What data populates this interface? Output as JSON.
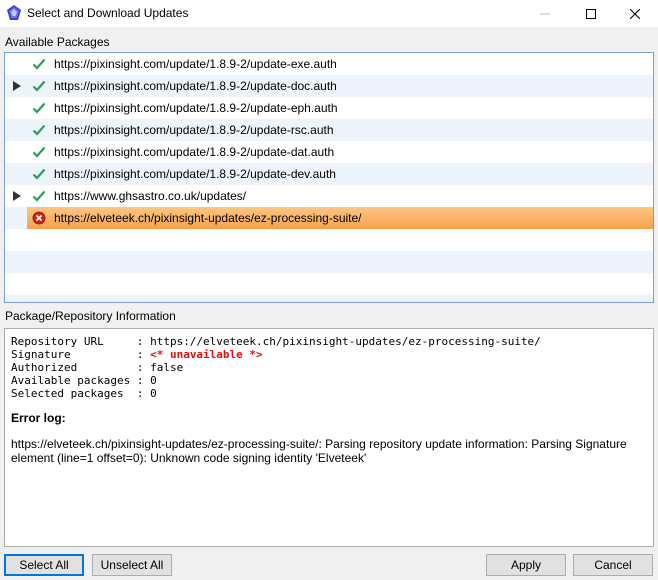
{
  "window": {
    "title": "Select and Download Updates"
  },
  "packages_section": {
    "label": "Available Packages",
    "items": [
      {
        "url": "https://pixinsight.com/update/1.8.9-2/update-exe.auth",
        "status": "ok",
        "expandable": false
      },
      {
        "url": "https://pixinsight.com/update/1.8.9-2/update-doc.auth",
        "status": "ok",
        "expandable": true
      },
      {
        "url": "https://pixinsight.com/update/1.8.9-2/update-eph.auth",
        "status": "ok",
        "expandable": false
      },
      {
        "url": "https://pixinsight.com/update/1.8.9-2/update-rsc.auth",
        "status": "ok",
        "expandable": false
      },
      {
        "url": "https://pixinsight.com/update/1.8.9-2/update-dat.auth",
        "status": "ok",
        "expandable": false
      },
      {
        "url": "https://pixinsight.com/update/1.8.9-2/update-dev.auth",
        "status": "ok",
        "expandable": false
      },
      {
        "url": "https://www.ghsastro.co.uk/updates/",
        "status": "ok",
        "expandable": true
      },
      {
        "url": "https://elveteek.ch/pixinsight-updates/ez-processing-suite/",
        "status": "error",
        "expandable": false,
        "selected": true
      }
    ]
  },
  "info_section": {
    "label": "Package/Repository Information",
    "fields": {
      "repository_url_label": "Repository URL     :",
      "repository_url_value": " https://elveteek.ch/pixinsight-updates/ez-processing-suite/",
      "signature_label": "Signature          :",
      "signature_value": "<* unavailable *>",
      "authorized_label": "Authorized         :",
      "authorized_value": " false",
      "available_label": "Available packages :",
      "available_value": " 0",
      "selected_label": "Selected packages  :",
      "selected_value": " 0"
    },
    "error_log_heading": "Error log:",
    "error_log_text": "https://elveteek.ch/pixinsight-updates/ez-processing-suite/: Parsing repository update information: Parsing Signature element (line=1 offset=0): Unknown code signing identity 'Elveteek'"
  },
  "buttons": {
    "select_all": "Select All",
    "unselect_all": "Unselect All",
    "apply": "Apply",
    "cancel": "Cancel"
  },
  "colors": {
    "selection_top": "#fcc684",
    "selection_bottom": "#f6a24a",
    "ok_check": "#2e9e5b",
    "error_red": "#c42b1c",
    "unavailable_text": "#e01010",
    "list_border": "#7a9ed8",
    "alt_row": "#eef4fb"
  },
  "icons": {
    "app": "pixinsight-logo-icon",
    "ok": "checkmark-icon",
    "error": "error-circle-icon",
    "expander": "expand-arrow-icon"
  }
}
